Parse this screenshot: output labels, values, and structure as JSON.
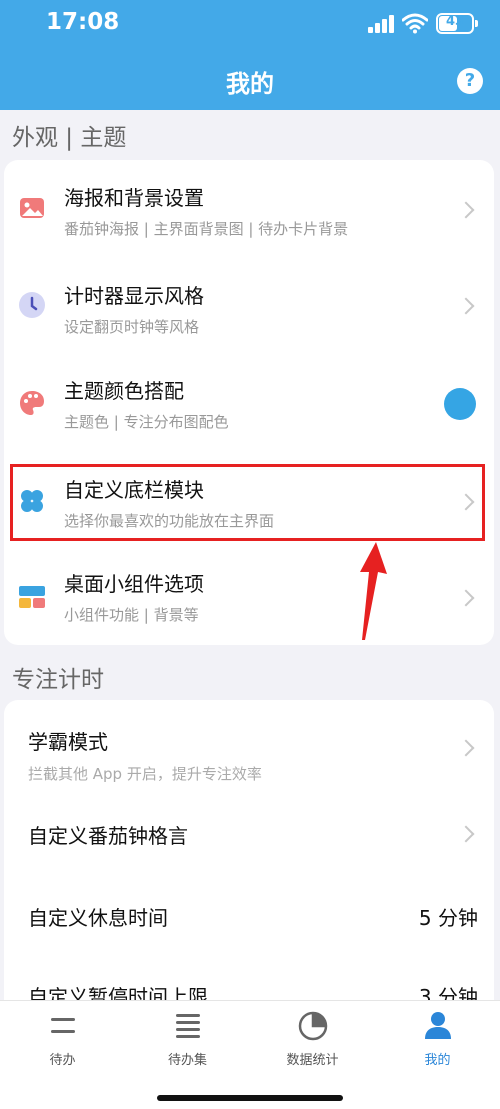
{
  "status_bar": {
    "time": "17:08",
    "battery": "43"
  },
  "nav": {
    "title": "我的",
    "help_label": "?"
  },
  "section_appearance": {
    "title": "外观 | 主题",
    "items": [
      {
        "title": "海报和背景设置",
        "subtitle": "番茄钟海报 | 主界面背景图 | 待办卡片背景",
        "icon": "image-icon"
      },
      {
        "title": "计时器显示风格",
        "subtitle": "设定翻页时钟等风格",
        "icon": "clock-icon"
      },
      {
        "title": "主题颜色搭配",
        "subtitle": "主题色 | 专注分布图配色",
        "icon": "palette-icon",
        "theme_color": "#35a5e4"
      },
      {
        "title": "自定义底栏模块",
        "subtitle": "选择你最喜欢的功能放在主界面",
        "icon": "clover-icon"
      },
      {
        "title": "桌面小组件选项",
        "subtitle": "小组件功能 | 背景等",
        "icon": "widget-icon"
      }
    ]
  },
  "section_focus": {
    "title": "专注计时",
    "items": [
      {
        "title": "学霸模式",
        "subtitle": "拦截其他 App 开启，提升专注效率"
      },
      {
        "title": "自定义番茄钟格言"
      },
      {
        "title": "自定义休息时间",
        "value": "5 分钟"
      },
      {
        "title": "自定义暂停时间上限",
        "value": "3 分钟"
      }
    ]
  },
  "tabs": [
    {
      "label": "待办",
      "icon": "todo-icon",
      "active": false
    },
    {
      "label": "待办集",
      "icon": "todo-set-icon",
      "active": false
    },
    {
      "label": "数据统计",
      "icon": "pie-chart-icon",
      "active": false
    },
    {
      "label": "我的",
      "icon": "profile-icon",
      "active": true
    }
  ],
  "colors": {
    "accent": "#43a9e8",
    "highlight": "#e62121",
    "active_tab": "#2b86d8"
  }
}
